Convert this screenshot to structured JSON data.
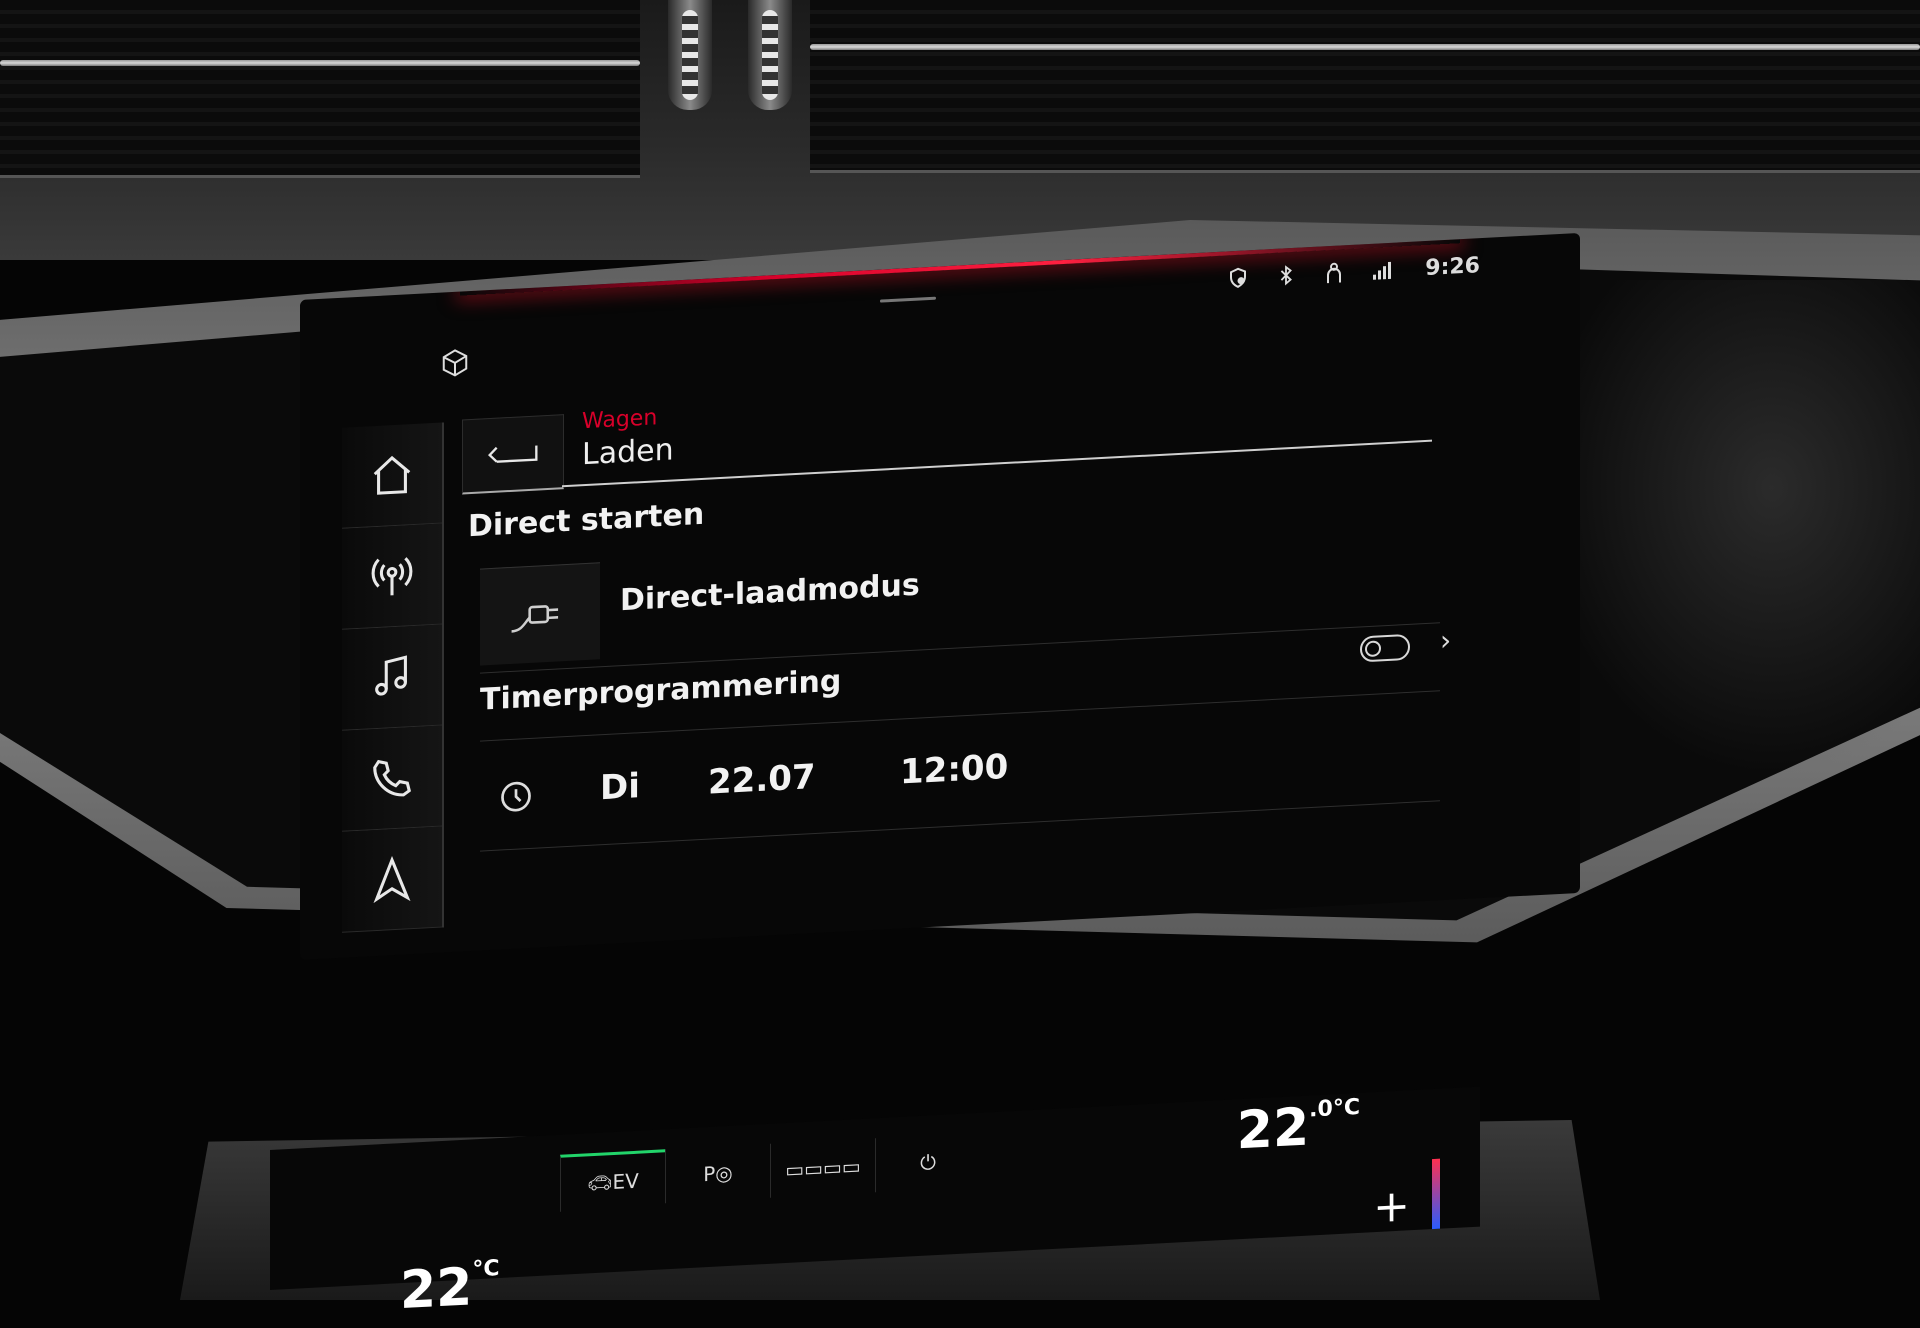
{
  "status_bar": {
    "icons": [
      "location-shield-icon",
      "bluetooth-icon",
      "passenger-icon",
      "signal-icon"
    ],
    "time": "9:26"
  },
  "header": {
    "parent": "Wagen",
    "title": "Laden"
  },
  "sidebar": {
    "items": [
      {
        "icon": "home-icon"
      },
      {
        "icon": "radio-icon"
      },
      {
        "icon": "music-icon"
      },
      {
        "icon": "phone-icon"
      },
      {
        "icon": "navigation-icon"
      }
    ]
  },
  "direct_start": {
    "section_title": "Direct starten",
    "item_label": "Direct-laadmodus",
    "item_icon": "charging-plug-icon"
  },
  "timer": {
    "section_title": "Timerprogrammering",
    "toggle_state": "off",
    "entry": {
      "day": "Di",
      "date": "22.07",
      "time": "12:00"
    }
  },
  "climate": {
    "tabs": [
      {
        "label": "EV",
        "active": true
      },
      {
        "label": "P",
        "active": false
      },
      {
        "label": "",
        "active": false
      },
      {
        "label": "",
        "active": false
      }
    ],
    "temp_right": "22",
    "temp_right_decimal": ".0",
    "temp_left": "22",
    "unit": "°C",
    "plus": "+"
  },
  "colors": {
    "accent_red": "#d8002a",
    "ev_green": "#22d46a"
  }
}
